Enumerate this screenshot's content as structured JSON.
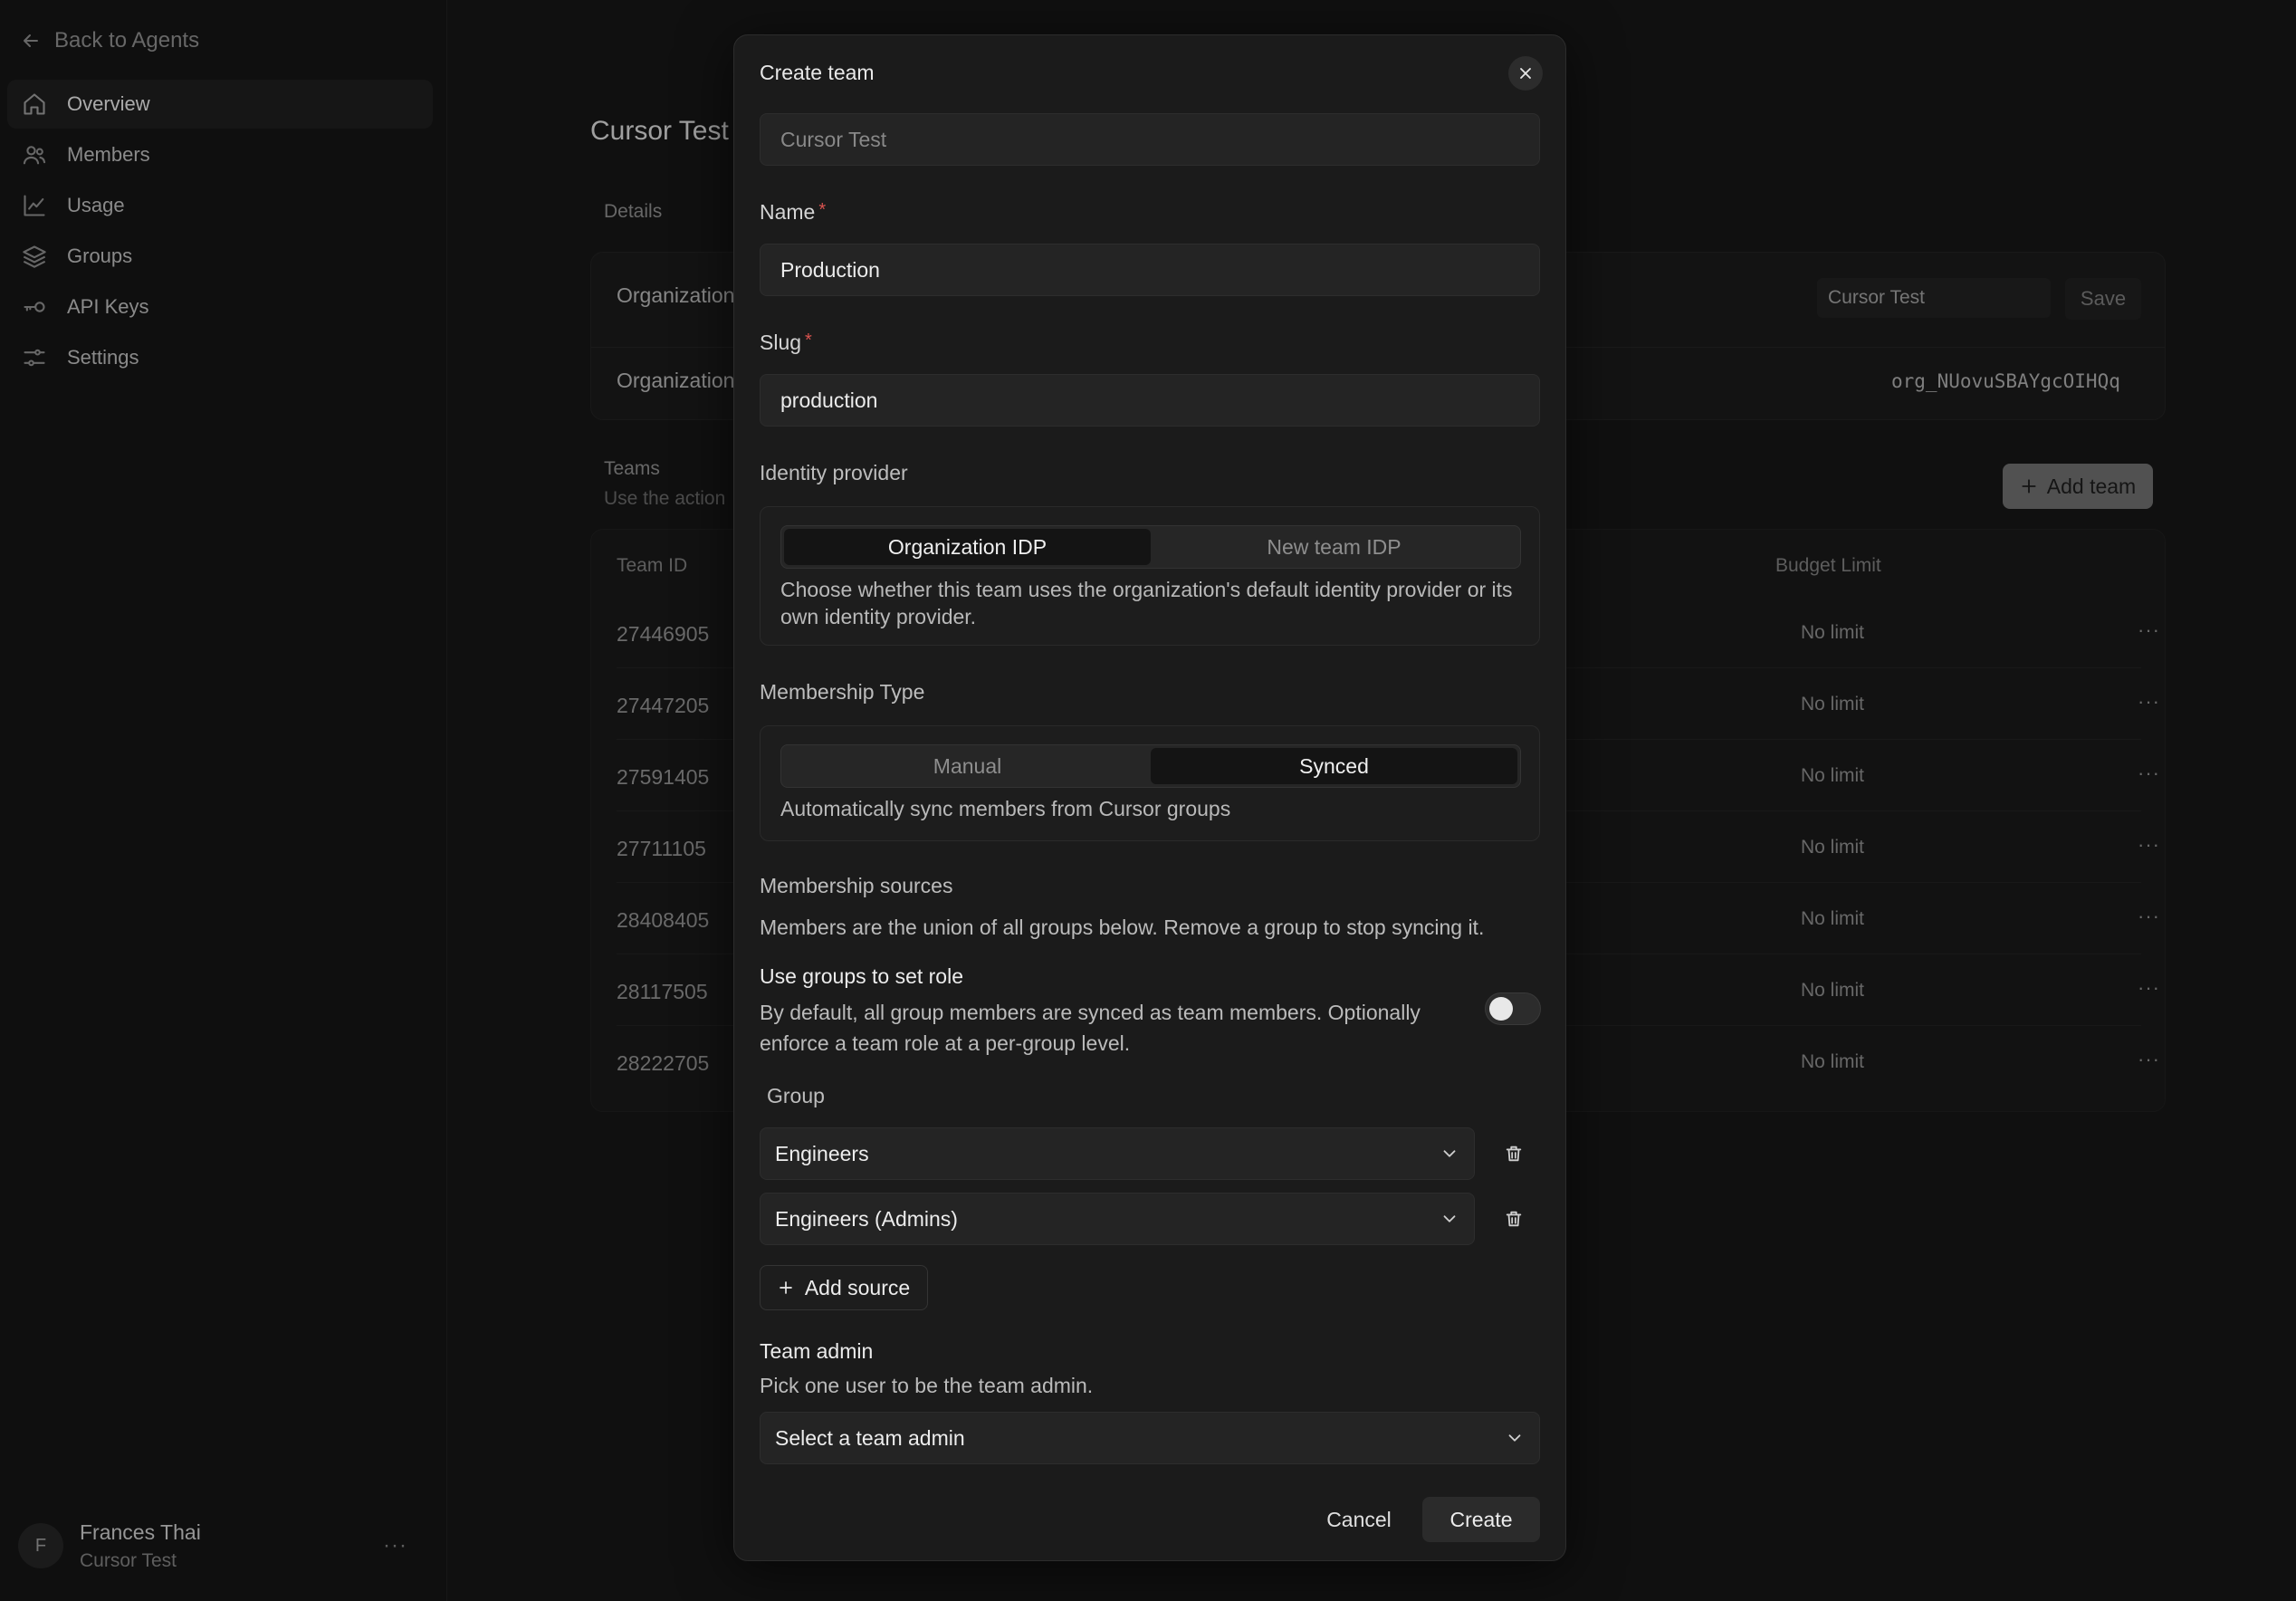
{
  "sidebar": {
    "back_label": "Back to Agents",
    "items": [
      {
        "label": "Overview",
        "icon": "home-icon",
        "active": true
      },
      {
        "label": "Members",
        "icon": "users-icon"
      },
      {
        "label": "Usage",
        "icon": "chart-line-icon"
      },
      {
        "label": "Groups",
        "icon": "layers-icon"
      },
      {
        "label": "API Keys",
        "icon": "key-icon"
      },
      {
        "label": "Settings",
        "icon": "sliders-icon"
      }
    ],
    "user": {
      "initial": "F",
      "name": "Frances Thai",
      "org": "Cursor Test",
      "more": "···"
    }
  },
  "main": {
    "title": "Cursor Test",
    "details_tab": "Details",
    "org_name_label": "Organization",
    "org_id_label": "Organization",
    "org_name_value": "Cursor Test",
    "save_label": "Save",
    "org_id_value": "org_NUovuSBAYgcOIHQq",
    "teams_label": "Teams",
    "teams_sub": "Use the action",
    "add_team_label": "Add team",
    "table": {
      "col_team_id": "Team ID",
      "col_budget": "Budget Limit",
      "rows": [
        {
          "id": "27446905",
          "budget": "No limit"
        },
        {
          "id": "27447205",
          "budget": "No limit"
        },
        {
          "id": "27591405",
          "budget": "No limit"
        },
        {
          "id": "27711105",
          "budget": "No limit"
        },
        {
          "id": "28408405",
          "budget": "No limit"
        },
        {
          "id": "28117505",
          "budget": "No limit"
        },
        {
          "id": "28222705",
          "budget": "No limit"
        }
      ],
      "more": "···"
    }
  },
  "modal": {
    "title": "Create team",
    "org_field_value": "Cursor Test",
    "name_label": "Name",
    "name_value": "Production",
    "slug_label": "Slug",
    "slug_value": "production",
    "required_mark": "*",
    "idp_label": "Identity provider",
    "idp_options": [
      "Organization IDP",
      "New team IDP"
    ],
    "idp_selected": "Organization IDP",
    "idp_help": "Choose whether this team uses the organization's default identity provider or its own identity provider.",
    "membership_label": "Membership Type",
    "membership_options": [
      "Manual",
      "Synced"
    ],
    "membership_selected": "Synced",
    "membership_help": "Automatically sync members from Cursor groups",
    "sources_label": "Membership sources",
    "sources_desc": "Members are the union of all groups below. Remove a group to stop syncing it.",
    "groups_role_label": "Use groups to set role",
    "groups_role_desc": "By default, all group members are synced as team members. Optionally enforce a team role at a per-group level.",
    "groups_role_enabled": false,
    "group_col_label": "Group",
    "groups": [
      "Engineers",
      "Engineers (Admins)"
    ],
    "add_source_label": "Add source",
    "team_admin_label": "Team admin",
    "team_admin_desc": "Pick one user to be the team admin.",
    "team_admin_placeholder": "Select a team admin",
    "cancel_label": "Cancel",
    "create_label": "Create"
  }
}
